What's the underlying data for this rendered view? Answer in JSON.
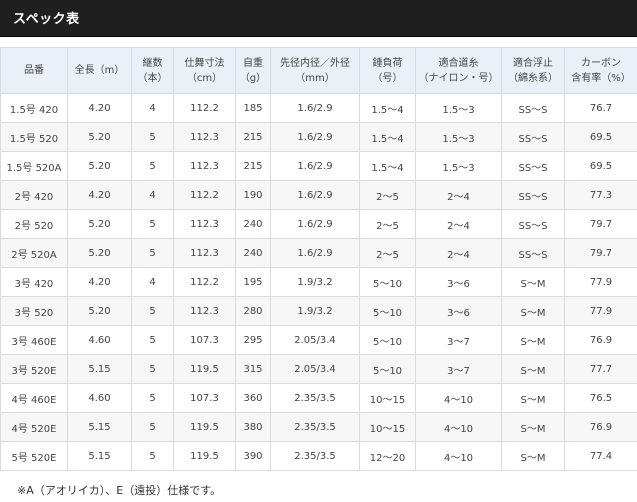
{
  "header": {
    "title": "スペック表"
  },
  "table": {
    "columns": [
      "品番",
      "全長（m）",
      "継数\n（本）",
      "仕舞寸法\n（cm）",
      "自重\n（g）",
      "先径内径／外径\n（mm）",
      "錘負荷\n（号）",
      "適合道糸\n（ナイロン・号）",
      "適合浮止\n（綿糸系）",
      "カーボン\n含有率（%）"
    ],
    "rows": [
      [
        "1.5号 420",
        "4.20",
        "4",
        "112.2",
        "185",
        "1.6/2.9",
        "1.5〜4",
        "1.5〜3",
        "SS〜S",
        "76.7"
      ],
      [
        "1.5号 520",
        "5.20",
        "5",
        "112.3",
        "215",
        "1.6/2.9",
        "1.5〜4",
        "1.5〜3",
        "SS〜S",
        "69.5"
      ],
      [
        "1.5号 520A",
        "5.20",
        "5",
        "112.3",
        "215",
        "1.6/2.9",
        "1.5〜4",
        "1.5〜3",
        "SS〜S",
        "69.5"
      ],
      [
        "2号 420",
        "4.20",
        "4",
        "112.2",
        "190",
        "1.6/2.9",
        "2〜5",
        "2〜4",
        "SS〜S",
        "77.3"
      ],
      [
        "2号 520",
        "5.20",
        "5",
        "112.3",
        "240",
        "1.6/2.9",
        "2〜5",
        "2〜4",
        "SS〜S",
        "79.7"
      ],
      [
        "2号 520A",
        "5.20",
        "5",
        "112.3",
        "240",
        "1.6/2.9",
        "2〜5",
        "2〜4",
        "SS〜S",
        "79.7"
      ],
      [
        "3号 420",
        "4.20",
        "4",
        "112.2",
        "195",
        "1.9/3.2",
        "5〜10",
        "3〜6",
        "S〜M",
        "77.9"
      ],
      [
        "3号 520",
        "5.20",
        "5",
        "112.3",
        "280",
        "1.9/3.2",
        "5〜10",
        "3〜6",
        "S〜M",
        "77.9"
      ],
      [
        "3号 460E",
        "4.60",
        "5",
        "107.3",
        "295",
        "2.05/3.4",
        "5〜10",
        "3〜7",
        "S〜M",
        "76.9"
      ],
      [
        "3号 520E",
        "5.15",
        "5",
        "119.5",
        "315",
        "2.05/3.4",
        "5〜10",
        "3〜7",
        "S〜M",
        "77.7"
      ],
      [
        "4号 460E",
        "4.60",
        "5",
        "107.3",
        "360",
        "2.35/3.5",
        "10〜15",
        "4〜10",
        "S〜M",
        "76.5"
      ],
      [
        "4号 520E",
        "5.15",
        "5",
        "119.5",
        "380",
        "2.35/3.5",
        "10〜15",
        "4〜10",
        "S〜M",
        "76.9"
      ],
      [
        "5号 520E",
        "5.15",
        "5",
        "119.5",
        "390",
        "2.35/3.5",
        "12〜20",
        "4〜10",
        "S〜M",
        "77.4"
      ]
    ]
  },
  "note": "※A（アオリイカ）、E（遠投）仕様です。"
}
